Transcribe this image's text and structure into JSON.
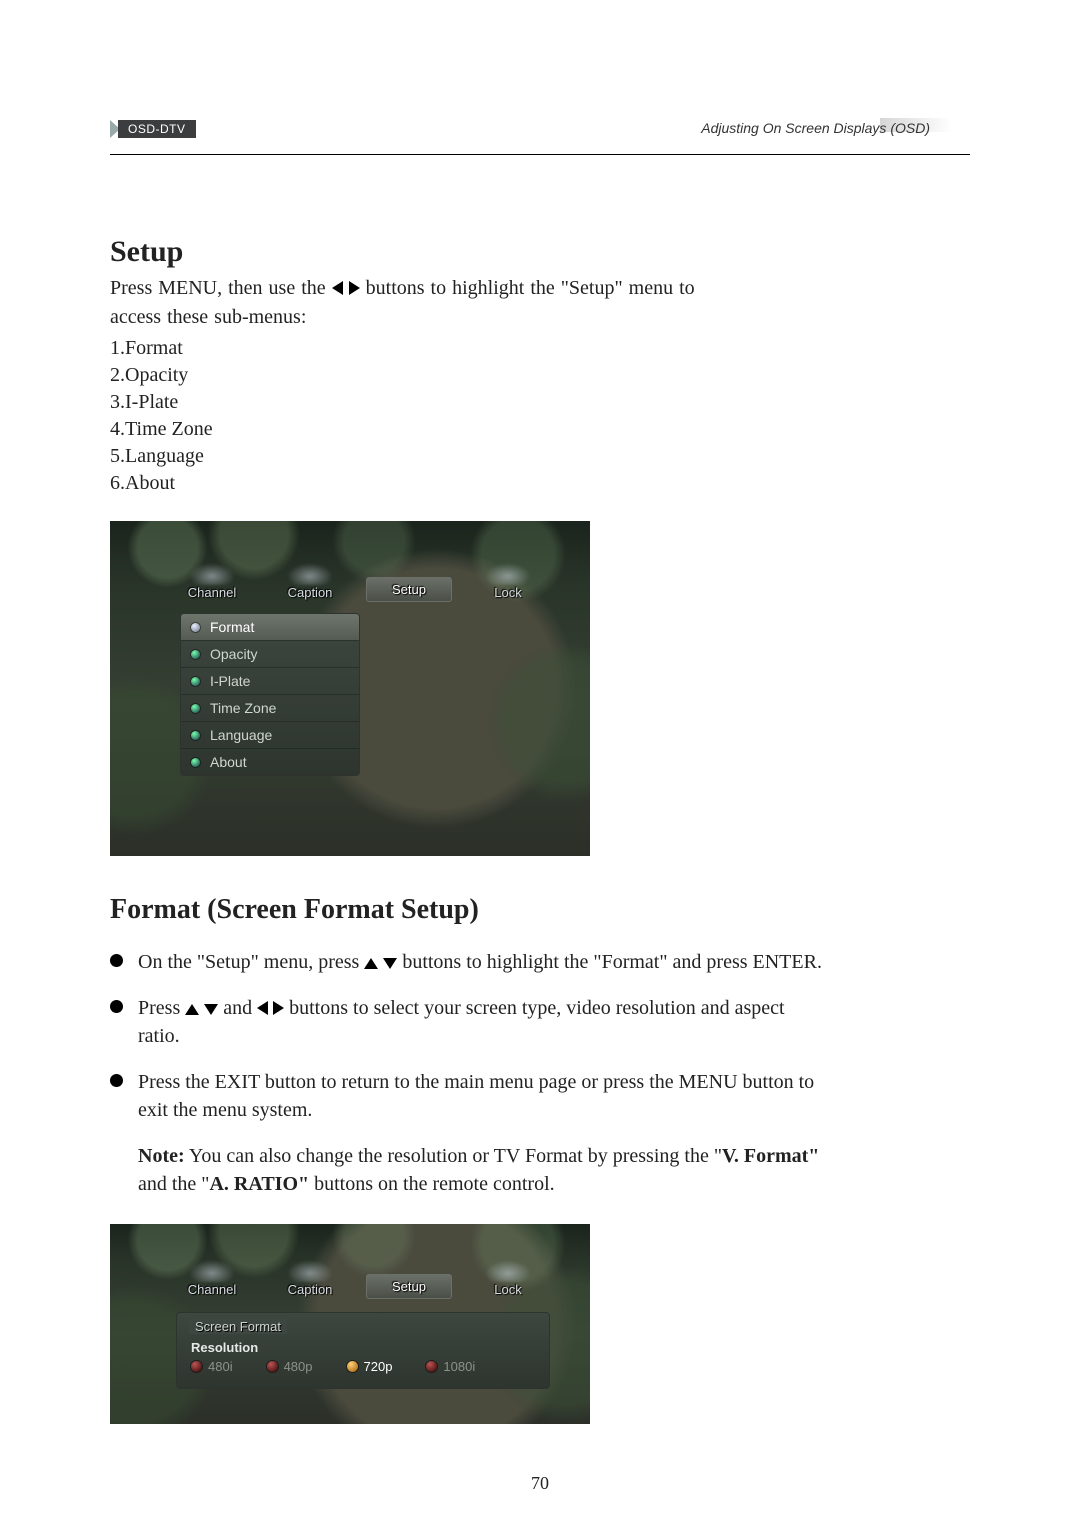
{
  "header": {
    "tag": "OSD-DTV",
    "right": "Adjusting On Screen Displays (OSD)"
  },
  "section1": {
    "title": "Setup",
    "intro_a": "Press MENU, then use the ",
    "intro_b": " buttons to highlight the \"Setup\" menu to",
    "intro_c": "access these sub-menus:",
    "items": [
      "1.Format",
      "2.Opacity",
      "3.I-Plate",
      "4.Time Zone",
      "5.Language",
      "6.About"
    ]
  },
  "tv1": {
    "tabs": [
      "Channel",
      "Caption",
      "Setup",
      "Lock"
    ],
    "active_tab": 2,
    "menu": [
      "Format",
      "Opacity",
      "I-Plate",
      "Time  Zone",
      "Language",
      "About"
    ],
    "selected": 0
  },
  "section2": {
    "title": "Format (Screen Format Setup)",
    "b1a": "On the \"Setup\" menu, press ",
    "b1b": " buttons to highlight the \"Format\" and press ENTER.",
    "b2a": "Press ",
    "b2mid": " and ",
    "b2b": "  buttons to select your screen type, video resolution and aspect ratio.",
    "b3": "Press the EXIT button to return to the main menu page or press the MENU button to exit the menu system.",
    "note_label": "Note:",
    "note_a": " You can also change the resolution or TV Format by pressing the \"",
    "note_vf": "V. Format\"",
    "note_mid": " and the \"",
    "note_ar": "A. RATIO\"",
    "note_end": " buttons on the remote control."
  },
  "tv2": {
    "tabs": [
      "Channel",
      "Caption",
      "Setup",
      "Lock"
    ],
    "active_tab": 2,
    "panel_title": "Screen  Format",
    "row_label": "Resolution",
    "options": [
      "480i",
      "480p",
      "720p",
      "1080i"
    ],
    "selected": 2
  },
  "page_number": "70"
}
